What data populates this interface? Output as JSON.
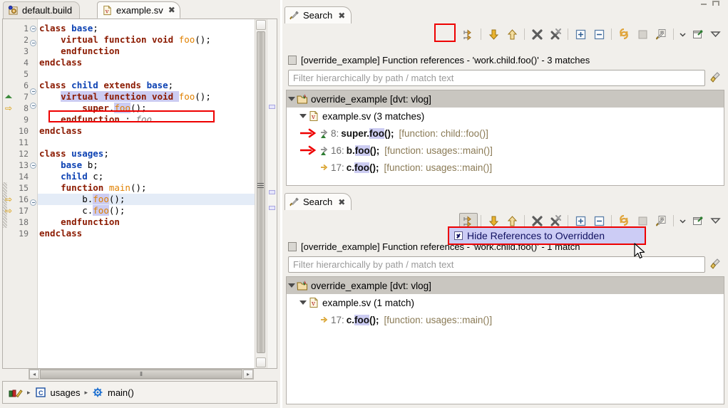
{
  "editor": {
    "tabs": [
      {
        "label": "default.build",
        "icon": "build-file-icon",
        "active": false,
        "closable": false
      },
      {
        "label": "example.sv",
        "icon": "verilog-file-icon",
        "active": true,
        "closable": true,
        "close_glyph": "✖"
      }
    ],
    "lines": [
      {
        "n": "1",
        "fold": true,
        "marker": "",
        "change": false,
        "current": false,
        "tokens": [
          {
            "t": "class",
            "c": "kw"
          },
          {
            "t": " ",
            "c": "pl"
          },
          {
            "t": "base",
            "c": "typ"
          },
          {
            "t": ";",
            "c": "pl"
          }
        ]
      },
      {
        "n": "2",
        "fold": true,
        "marker": "",
        "change": false,
        "current": false,
        "tokens": [
          {
            "t": "    ",
            "c": "pl"
          },
          {
            "t": "virtual function void",
            "c": "kw"
          },
          {
            "t": " ",
            "c": "pl"
          },
          {
            "t": "foo",
            "c": "fn"
          },
          {
            "t": "();",
            "c": "pl"
          }
        ]
      },
      {
        "n": "3",
        "fold": false,
        "marker": "",
        "change": false,
        "current": false,
        "tokens": [
          {
            "t": "    ",
            "c": "pl"
          },
          {
            "t": "endfunction",
            "c": "kw"
          }
        ]
      },
      {
        "n": "4",
        "fold": false,
        "marker": "",
        "change": false,
        "current": false,
        "tokens": [
          {
            "t": "endclass",
            "c": "kw"
          }
        ]
      },
      {
        "n": "5",
        "fold": false,
        "marker": "",
        "change": false,
        "current": false,
        "tokens": []
      },
      {
        "n": "6",
        "fold": true,
        "marker": "",
        "change": false,
        "current": false,
        "tokens": [
          {
            "t": "class",
            "c": "kw"
          },
          {
            "t": " ",
            "c": "pl"
          },
          {
            "t": "child",
            "c": "typ"
          },
          {
            "t": " ",
            "c": "pl"
          },
          {
            "t": "extends",
            "c": "kw"
          },
          {
            "t": " ",
            "c": "pl"
          },
          {
            "t": "base",
            "c": "typ"
          },
          {
            "t": ";",
            "c": "pl"
          }
        ]
      },
      {
        "n": "7",
        "fold": true,
        "marker": "override-green-triangle",
        "change": false,
        "current": false,
        "boxed": true,
        "tokens": [
          {
            "t": "    ",
            "c": "pl"
          },
          {
            "t": "virtual function void",
            "c": "kw occ"
          },
          {
            "t": " ",
            "c": "occ"
          },
          {
            "t": "foo",
            "c": "fn"
          },
          {
            "t": "();",
            "c": "pl"
          }
        ]
      },
      {
        "n": "8",
        "fold": false,
        "marker": "implements-yellow-arrow",
        "change": false,
        "current": false,
        "tokens": [
          {
            "t": "        ",
            "c": "pl"
          },
          {
            "t": "super",
            "c": "kw"
          },
          {
            "t": ".",
            "c": "pl"
          },
          {
            "t": "foo",
            "c": "fn occ"
          },
          {
            "t": "();",
            "c": "pl"
          }
        ]
      },
      {
        "n": "9",
        "fold": false,
        "marker": "",
        "change": false,
        "current": false,
        "tokens": [
          {
            "t": "    ",
            "c": "pl"
          },
          {
            "t": "endfunction",
            "c": "kw"
          },
          {
            "t": " : ",
            "c": "pl"
          },
          {
            "t": "foo",
            "c": "cmt"
          }
        ]
      },
      {
        "n": "10",
        "fold": false,
        "marker": "",
        "change": false,
        "current": false,
        "tokens": [
          {
            "t": "endclass",
            "c": "kw"
          }
        ]
      },
      {
        "n": "11",
        "fold": false,
        "marker": "",
        "change": false,
        "current": false,
        "tokens": []
      },
      {
        "n": "12",
        "fold": true,
        "marker": "",
        "change": false,
        "current": false,
        "tokens": [
          {
            "t": "class",
            "c": "kw"
          },
          {
            "t": " ",
            "c": "pl"
          },
          {
            "t": "usages",
            "c": "typ"
          },
          {
            "t": ";",
            "c": "pl"
          }
        ]
      },
      {
        "n": "13",
        "fold": false,
        "marker": "",
        "change": false,
        "current": false,
        "tokens": [
          {
            "t": "    ",
            "c": "pl"
          },
          {
            "t": "base",
            "c": "typ"
          },
          {
            "t": " b;",
            "c": "pl"
          }
        ]
      },
      {
        "n": "14",
        "fold": false,
        "marker": "",
        "change": false,
        "current": false,
        "tokens": [
          {
            "t": "    ",
            "c": "pl"
          },
          {
            "t": "child",
            "c": "typ"
          },
          {
            "t": " c;",
            "c": "pl"
          }
        ]
      },
      {
        "n": "15",
        "fold": true,
        "marker": "",
        "change": true,
        "current": false,
        "tokens": [
          {
            "t": "    ",
            "c": "pl"
          },
          {
            "t": "function",
            "c": "kw"
          },
          {
            "t": " ",
            "c": "pl"
          },
          {
            "t": "main",
            "c": "fn"
          },
          {
            "t": "();",
            "c": "pl"
          }
        ]
      },
      {
        "n": "16",
        "fold": false,
        "marker": "implements-yellow-arrow",
        "change": true,
        "current": true,
        "tokens": [
          {
            "t": "        ",
            "c": "pl"
          },
          {
            "t": "b.",
            "c": "pl"
          },
          {
            "t": "foo",
            "c": "fn occ"
          },
          {
            "t": "();",
            "c": "pl"
          }
        ]
      },
      {
        "n": "17",
        "fold": false,
        "marker": "implements-yellow-arrow",
        "change": true,
        "current": false,
        "tokens": [
          {
            "t": "        ",
            "c": "pl"
          },
          {
            "t": "c.",
            "c": "pl"
          },
          {
            "t": "foo",
            "c": "fn occ"
          },
          {
            "t": "();",
            "c": "pl"
          }
        ]
      },
      {
        "n": "18",
        "fold": false,
        "marker": "",
        "change": true,
        "current": false,
        "tokens": [
          {
            "t": "    ",
            "c": "pl"
          },
          {
            "t": "endfunction",
            "c": "kw"
          }
        ]
      },
      {
        "n": "19",
        "fold": false,
        "marker": "",
        "change": false,
        "current": false,
        "tokens": [
          {
            "t": "endclass",
            "c": "kw"
          }
        ]
      }
    ],
    "hscroll": {
      "left_glyph": "◂",
      "right_glyph": "▸",
      "thumb_glyph": "⦀"
    },
    "breadcrumb": {
      "items": [
        {
          "label": "",
          "icon": "source-library-icon"
        },
        {
          "label": "usages",
          "icon": "class-icon"
        },
        {
          "label": "main()",
          "icon": "function-gear-icon"
        }
      ],
      "separator": "▸"
    }
  },
  "window_controls": {
    "minimize": "minimize-icon",
    "maximize": "maximize-icon"
  },
  "search_panels": [
    {
      "id": "search-top",
      "tab_label": "Search",
      "tab_close_glyph": "✖",
      "header": "[override_example] Function references - 'work.child.foo()' - 3 matches",
      "filter_placeholder": "Filter hierarchically by path / match text",
      "toolbar": [
        {
          "name": "expand-to-match-button",
          "pressed": false
        },
        {
          "name": "show-next-match-button",
          "pressed": false
        },
        {
          "name": "show-previous-match-button",
          "pressed": false
        },
        {
          "name": "remove-selected-matches-button",
          "pressed": false
        },
        {
          "name": "remove-all-matches-button",
          "pressed": false
        },
        {
          "name": "expand-all-button",
          "pressed": false
        },
        {
          "name": "collapse-all-button",
          "pressed": false
        },
        {
          "name": "run-current-search-again-button",
          "pressed": false
        },
        {
          "name": "cancel-current-search-button",
          "pressed": false
        },
        {
          "name": "previous-search-history-button",
          "pressed": false
        },
        {
          "name": "search-history-dropdown-button",
          "pressed": false
        },
        {
          "name": "pin-search-view-button",
          "pressed": false
        },
        {
          "name": "view-menu-button",
          "pressed": false
        }
      ],
      "tree": {
        "root": {
          "label": "override_example [dvt: vlog]",
          "icon": "project-icon",
          "expanded": true
        },
        "file": {
          "label": "example.sv (3 matches)",
          "icon": "verilog-file-icon",
          "expanded": true
        },
        "matches": [
          {
            "red_arrow": true,
            "icon": "match-overridden-icon",
            "line": "8:",
            "pre": "super.",
            "hit": "foo",
            "post": "();",
            "context": "[function: child::foo()]"
          },
          {
            "red_arrow": true,
            "icon": "match-overridden-icon",
            "line": "16:",
            "pre": "b.",
            "hit": "foo",
            "post": "();",
            "context": "[function: usages::main()]"
          },
          {
            "red_arrow": false,
            "icon": "match-icon",
            "line": "17:",
            "pre": "c.",
            "hit": "foo",
            "post": "();",
            "context": "[function: usages::main()]"
          }
        ]
      }
    },
    {
      "id": "search-bottom",
      "tab_label": "Search",
      "tab_close_glyph": "✖",
      "header": "[override_example] Function references - 'work.child.foo()' - 1 match",
      "filter_placeholder": "Filter hierarchically by path / match text",
      "toolbar": [
        {
          "name": "expand-to-match-button",
          "pressed": true
        },
        {
          "name": "show-next-match-button",
          "pressed": false
        },
        {
          "name": "show-previous-match-button",
          "pressed": false
        },
        {
          "name": "remove-selected-matches-button",
          "pressed": false
        },
        {
          "name": "remove-all-matches-button",
          "pressed": false
        },
        {
          "name": "expand-all-button",
          "pressed": false
        },
        {
          "name": "collapse-all-button",
          "pressed": false
        },
        {
          "name": "run-current-search-again-button",
          "pressed": false
        },
        {
          "name": "cancel-current-search-button",
          "pressed": false
        },
        {
          "name": "previous-search-history-button",
          "pressed": false
        },
        {
          "name": "search-history-dropdown-button",
          "pressed": false
        },
        {
          "name": "pin-search-view-button",
          "pressed": false
        },
        {
          "name": "view-menu-button",
          "pressed": false
        }
      ],
      "tree": {
        "root": {
          "label": "override_example [dvt: vlog]",
          "icon": "project-icon",
          "expanded": true
        },
        "file": {
          "label": "example.sv (1 match)",
          "icon": "verilog-file-icon",
          "expanded": true
        },
        "matches": [
          {
            "red_arrow": false,
            "icon": "match-icon",
            "line": "17:",
            "pre": "c.",
            "hit": "foo",
            "post": "();",
            "context": "[function: usages::main()]"
          }
        ]
      }
    }
  ],
  "overlay_menu": {
    "label": "Hide References to Overridden",
    "checked": true
  },
  "colors": {
    "keyword": "#8b1a00",
    "type": "#0d42b3",
    "function": "#e08000",
    "comment": "#808080",
    "occurrence_highlight": "#ccccf2",
    "annotation_red": "#ee0000",
    "menu_background": "#ccccf5",
    "current_line": "#e4ecf7",
    "tree_root_row": "#c9c6c0",
    "match_context": "#8a7a55"
  }
}
